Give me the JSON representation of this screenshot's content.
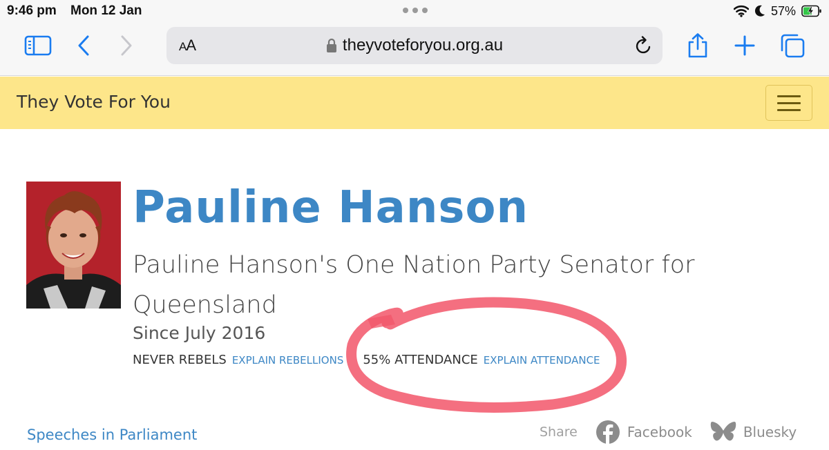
{
  "status_bar": {
    "time": "9:46 pm",
    "date": "Mon 12 Jan",
    "battery": "57%"
  },
  "browser": {
    "text_size_button": "AA",
    "url": "theyvoteforyou.org.au",
    "accent_color": "#1a7cf0"
  },
  "site": {
    "brand": "They Vote For You",
    "header_color": "#fde68a",
    "link_color": "#3d87c5"
  },
  "profile": {
    "name": "Pauline Hanson",
    "role": "Pauline Hanson's One Nation Party Senator for Queensland",
    "since": "Since July 2016",
    "rebels_label": "NEVER REBELS",
    "rebels_link": "EXPLAIN REBELLIONS",
    "attendance_label": "55% ATTENDANCE",
    "attendance_link": "EXPLAIN ATTENDANCE"
  },
  "footer_row": {
    "speeches_link": "Speeches in Parliament",
    "share_label": "Share",
    "share_links": [
      "Facebook",
      "Bluesky"
    ]
  },
  "annotation": {
    "description_color": "#f2566a"
  }
}
